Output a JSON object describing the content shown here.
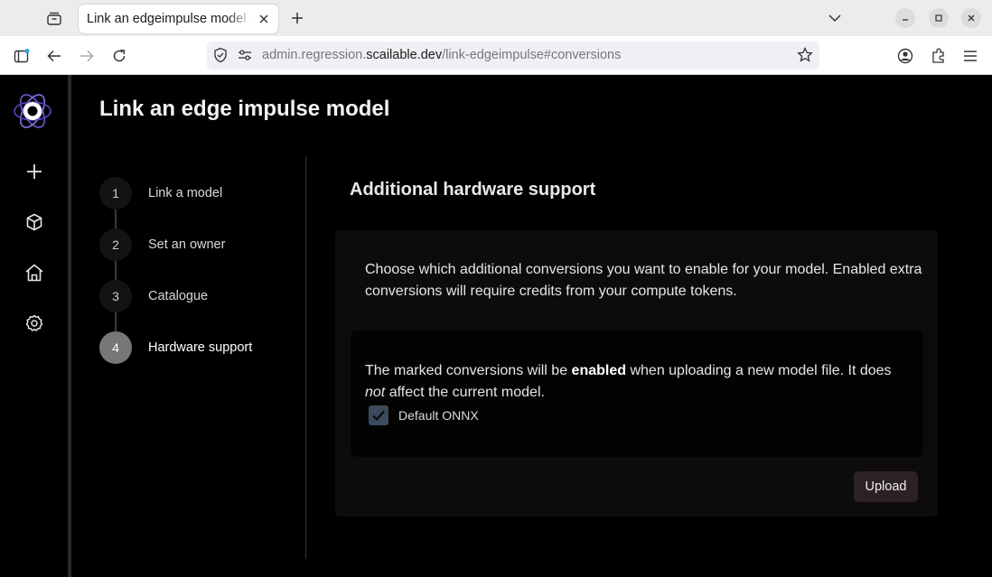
{
  "browser": {
    "tab_title": "Link an edgeimpulse model - Scailable",
    "url_scheme_host_prefix": "admin.regression.",
    "url_host": "scailable.dev",
    "url_path": "/link-edgeimpulse#conversions"
  },
  "page": {
    "title": "Link an edge impulse model"
  },
  "stepper": {
    "steps": [
      {
        "number": "1",
        "label": "Link a model"
      },
      {
        "number": "2",
        "label": "Set an owner"
      },
      {
        "number": "3",
        "label": "Catalogue"
      },
      {
        "number": "4",
        "label": "Hardware support"
      }
    ],
    "active_step": 4
  },
  "section": {
    "title": "Additional hardware support",
    "description": "Choose which additional conversions you want to enable for your model. Enabled extra conversions will require credits from your compute tokens.",
    "notice_part1": "The marked conversions will be ",
    "notice_bold": "enabled",
    "notice_part2": " when uploading a new model file. It does ",
    "notice_italic": "not",
    "notice_part3": " affect the current model.",
    "checkbox_label": "Default ONNX",
    "checkbox_checked": true,
    "upload_label": "Upload"
  },
  "colors": {
    "accent_logo": "#7b61d8",
    "upload_button": "#2d2223",
    "active_step": "#777777"
  }
}
